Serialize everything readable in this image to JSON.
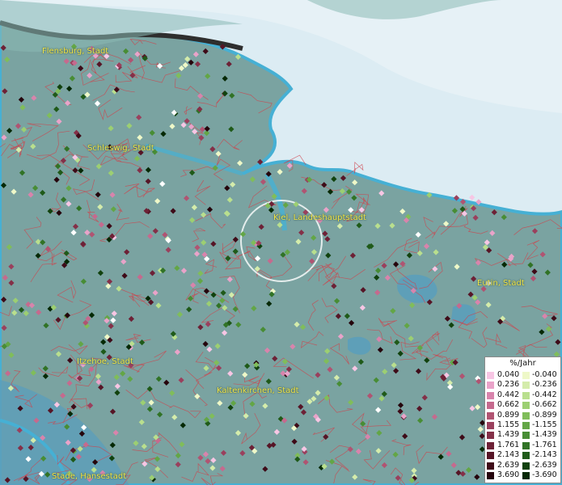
{
  "map": {
    "colors": {
      "sea": "#dcecf3",
      "land": "#7aa3a1",
      "coast": "#46b0d4",
      "district_lines": "#d0404a",
      "labels": "#f2e64a"
    },
    "cities": [
      {
        "name": "Flensburg, Stadt"
      },
      {
        "name": "Schleswig, Stadt"
      },
      {
        "name": "Kiel, Landeshauptstadt"
      },
      {
        "name": "Eutin, Stadt"
      },
      {
        "name": "Itzehoe, Stadt"
      },
      {
        "name": "Kaltenkirchen, Stadt"
      },
      {
        "name": "Stade, Hansestadt"
      }
    ],
    "highlight": {
      "label": "Kiel circle marker"
    }
  },
  "legend": {
    "title": "%/Jahr",
    "positive": [
      {
        "label": "0.040",
        "color": "#f7c6e4"
      },
      {
        "label": "0.236",
        "color": "#e9a3c9"
      },
      {
        "label": "0.442",
        "color": "#d884ac"
      },
      {
        "label": "0.662",
        "color": "#c56a8e"
      },
      {
        "label": "0.899",
        "color": "#b05472"
      },
      {
        "label": "1.155",
        "color": "#9a405d"
      },
      {
        "label": "1.439",
        "color": "#843048"
      },
      {
        "label": "1.761",
        "color": "#6d2136"
      },
      {
        "label": "2.143",
        "color": "#561526"
      },
      {
        "label": "2.639",
        "color": "#3e0b18"
      },
      {
        "label": "3.690",
        "color": "#25040c"
      }
    ],
    "negative": [
      {
        "label": "-0.040",
        "color": "#eef8c8"
      },
      {
        "label": "-0.236",
        "color": "#d4ecab"
      },
      {
        "label": "-0.442",
        "color": "#b9df8e"
      },
      {
        "label": "-0.662",
        "color": "#9ccf72"
      },
      {
        "label": "-0.899",
        "color": "#80bd5a"
      },
      {
        "label": "-1.155",
        "color": "#63a646"
      },
      {
        "label": "-1.439",
        "color": "#488d35"
      },
      {
        "label": "-1.761",
        "color": "#317326"
      },
      {
        "label": "-2.143",
        "color": "#1f5a19"
      },
      {
        "label": "-2.639",
        "color": "#11420e"
      },
      {
        "label": "-3.690",
        "color": "#062905"
      }
    ]
  }
}
